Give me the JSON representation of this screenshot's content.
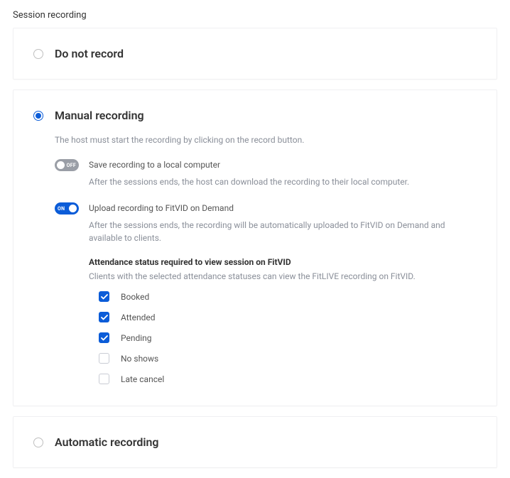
{
  "page": {
    "title": "Session recording"
  },
  "options": {
    "do_not_record": {
      "label": "Do not record",
      "selected": false
    },
    "manual": {
      "label": "Manual recording",
      "selected": true,
      "description": "The host must start the recording by clicking on the record button.",
      "save_local": {
        "on_text": "ON",
        "off_text": "OFF",
        "state": "off",
        "label": "Save recording to a local computer",
        "description": "After the sessions ends, the host can download the recording to their local computer."
      },
      "upload_fitvid": {
        "on_text": "ON",
        "off_text": "OFF",
        "state": "on",
        "label": "Upload recording to FitVID on Demand",
        "description": "After the sessions ends, the recording will be automatically uploaded to FitVID on Demand and available to clients."
      },
      "attendance": {
        "heading": "Attendance status required to view session on FitVID",
        "description": "Clients with the selected attendance statuses can view the FitLIVE recording on FitVID.",
        "items": [
          {
            "label": "Booked",
            "checked": true
          },
          {
            "label": "Attended",
            "checked": true
          },
          {
            "label": "Pending",
            "checked": true
          },
          {
            "label": "No shows",
            "checked": false
          },
          {
            "label": "Late cancel",
            "checked": false
          }
        ]
      }
    },
    "automatic": {
      "label": "Automatic recording",
      "selected": false
    }
  }
}
